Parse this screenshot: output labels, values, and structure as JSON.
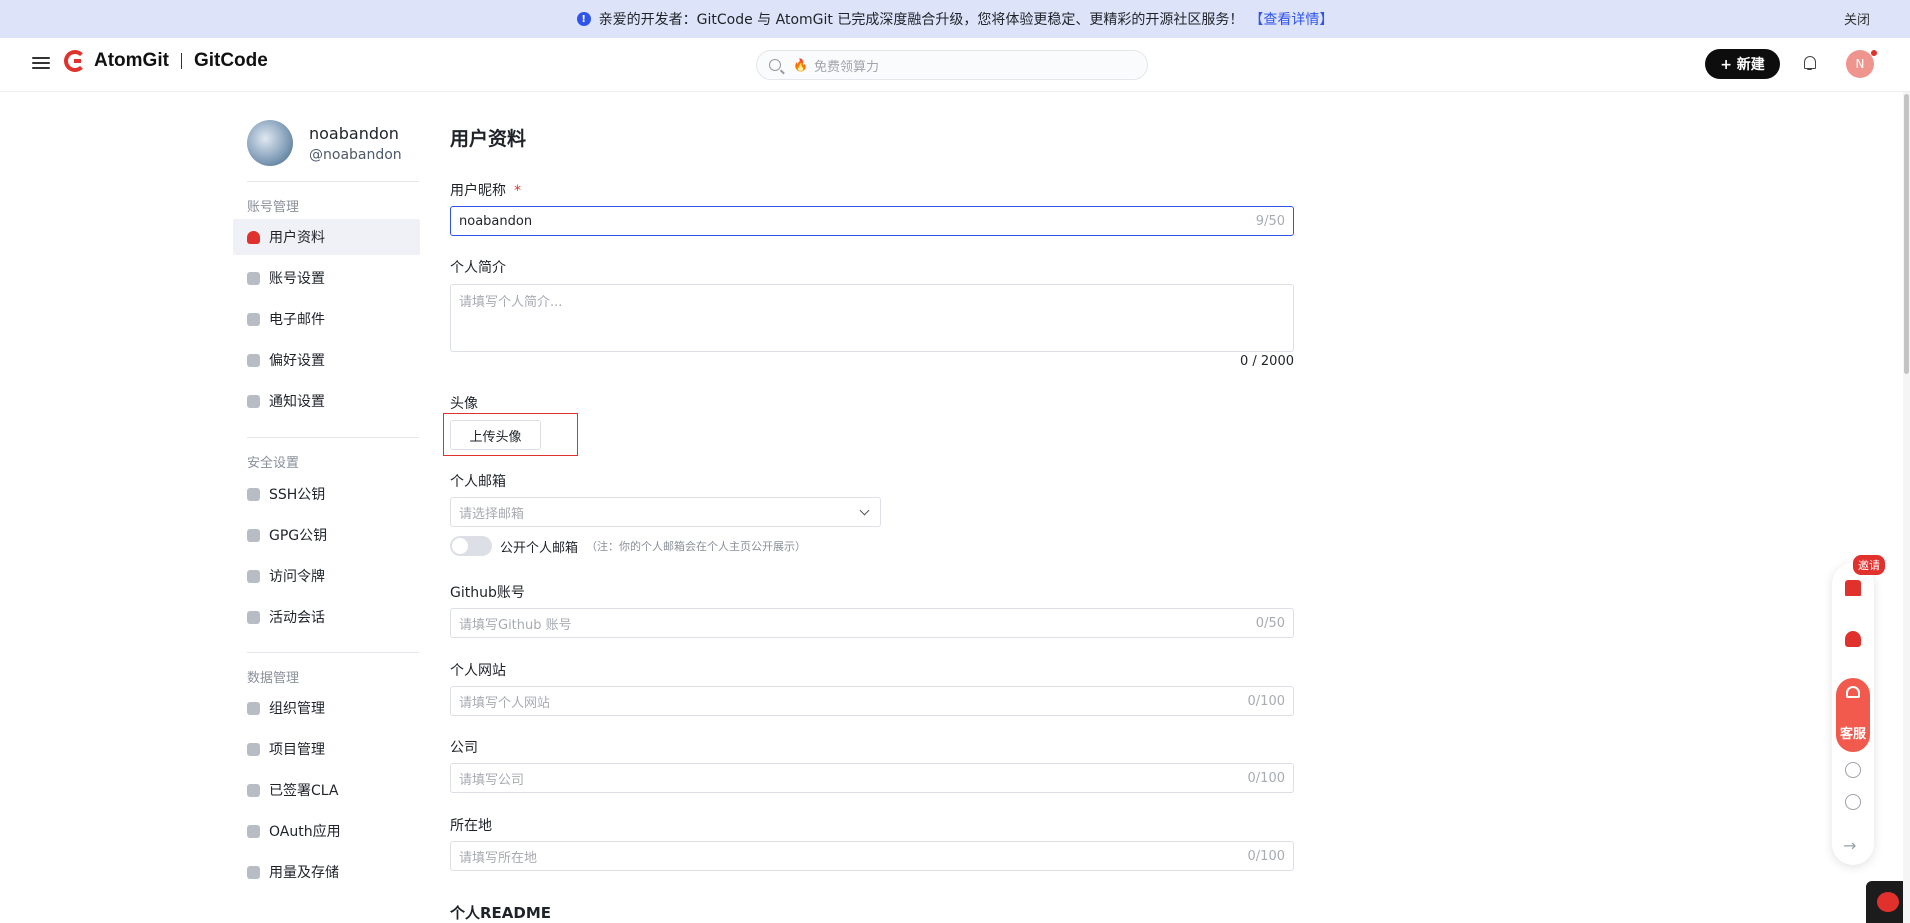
{
  "banner": {
    "message": "亲爱的开发者：GitCode 与 AtomGit 已完成深度融合升级，您将体验更稳定、更精彩的开源社区服务！",
    "link": "【查看详情】",
    "close": "关闭"
  },
  "header": {
    "brand1": "AtomGit",
    "brand2": "GitCode",
    "search_placeholder": "免费领算力",
    "new_button": "+ 新建",
    "avatar_initial": "N"
  },
  "sidebar": {
    "display_name": "noabandon",
    "handle": "@noabandon",
    "groups": [
      {
        "title": "账号管理",
        "items": [
          "用户资料",
          "账号设置",
          "电子邮件",
          "偏好设置",
          "通知设置"
        ]
      },
      {
        "title": "安全设置",
        "items": [
          "SSH公钥",
          "GPG公钥",
          "访问令牌",
          "活动会话"
        ]
      },
      {
        "title": "数据管理",
        "items": [
          "组织管理",
          "项目管理",
          "已签署CLA",
          "OAuth应用",
          "用量及存储"
        ]
      }
    ]
  },
  "form": {
    "title": "用户资料",
    "nickname_label": "用户昵称",
    "required_mark": "*",
    "nickname_value": "noabandon",
    "nickname_count": "9/50",
    "bio_label": "个人简介",
    "bio_placeholder": "请填写个人简介...",
    "bio_count": "0 / 2000",
    "avatar_label": "头像",
    "upload_button": "上传头像",
    "email_label": "个人邮箱",
    "email_placeholder": "请选择邮箱",
    "public_email_label": "公开个人邮箱",
    "public_email_note": "（注：你的个人邮箱会在个人主页公开展示）",
    "github_label": "Github账号",
    "github_placeholder": "请填写Github 账号",
    "github_count": "0/50",
    "website_label": "个人网站",
    "website_placeholder": "请填写个人网站",
    "website_count": "0/100",
    "company_label": "公司",
    "company_placeholder": "请填写公司",
    "company_count": "0/100",
    "location_label": "所在地",
    "location_placeholder": "请填写所在地",
    "location_count": "0/100",
    "readme_title": "个人README"
  },
  "float_bar": {
    "invite_badge": "邀请",
    "kefu_label": "客服"
  },
  "colors": {
    "brand_red": "#e0312d",
    "link_blue": "#2f54eb",
    "banner_bg": "#dde3f8"
  }
}
